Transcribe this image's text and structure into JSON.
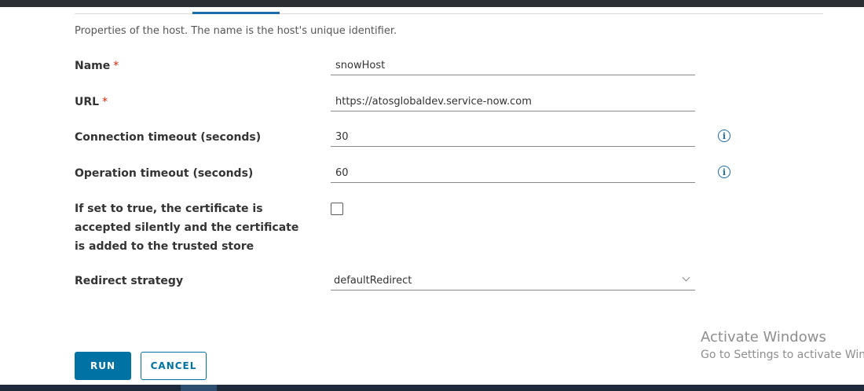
{
  "form": {
    "description": "Properties of the host. The name is the host's unique identifier.",
    "required_marker": "*",
    "fields": {
      "name": {
        "label": "Name",
        "value": "snowHost"
      },
      "url": {
        "label": "URL",
        "value": "https://atosglobaldev.service-now.com"
      },
      "connection_timeout": {
        "label": "Connection timeout (seconds)",
        "value": "30"
      },
      "operation_timeout": {
        "label": "Operation timeout (seconds)",
        "value": "60"
      },
      "certificate": {
        "label": "If set to true, the certificate is accepted silently and the certificate is added to the trusted store",
        "checked": false
      },
      "redirect_strategy": {
        "label": "Redirect strategy",
        "value": "defaultRedirect"
      }
    },
    "info_icon_glyph": "i"
  },
  "actions": {
    "run_label": "RUN",
    "cancel_label": "CANCEL"
  },
  "watermark": {
    "title": "Activate Windows",
    "subtitle": "Go to Settings to activate Windows."
  },
  "colors": {
    "accent": "#0072a3",
    "tab_indicator": "#1b6ca8",
    "required": "#e12200"
  }
}
